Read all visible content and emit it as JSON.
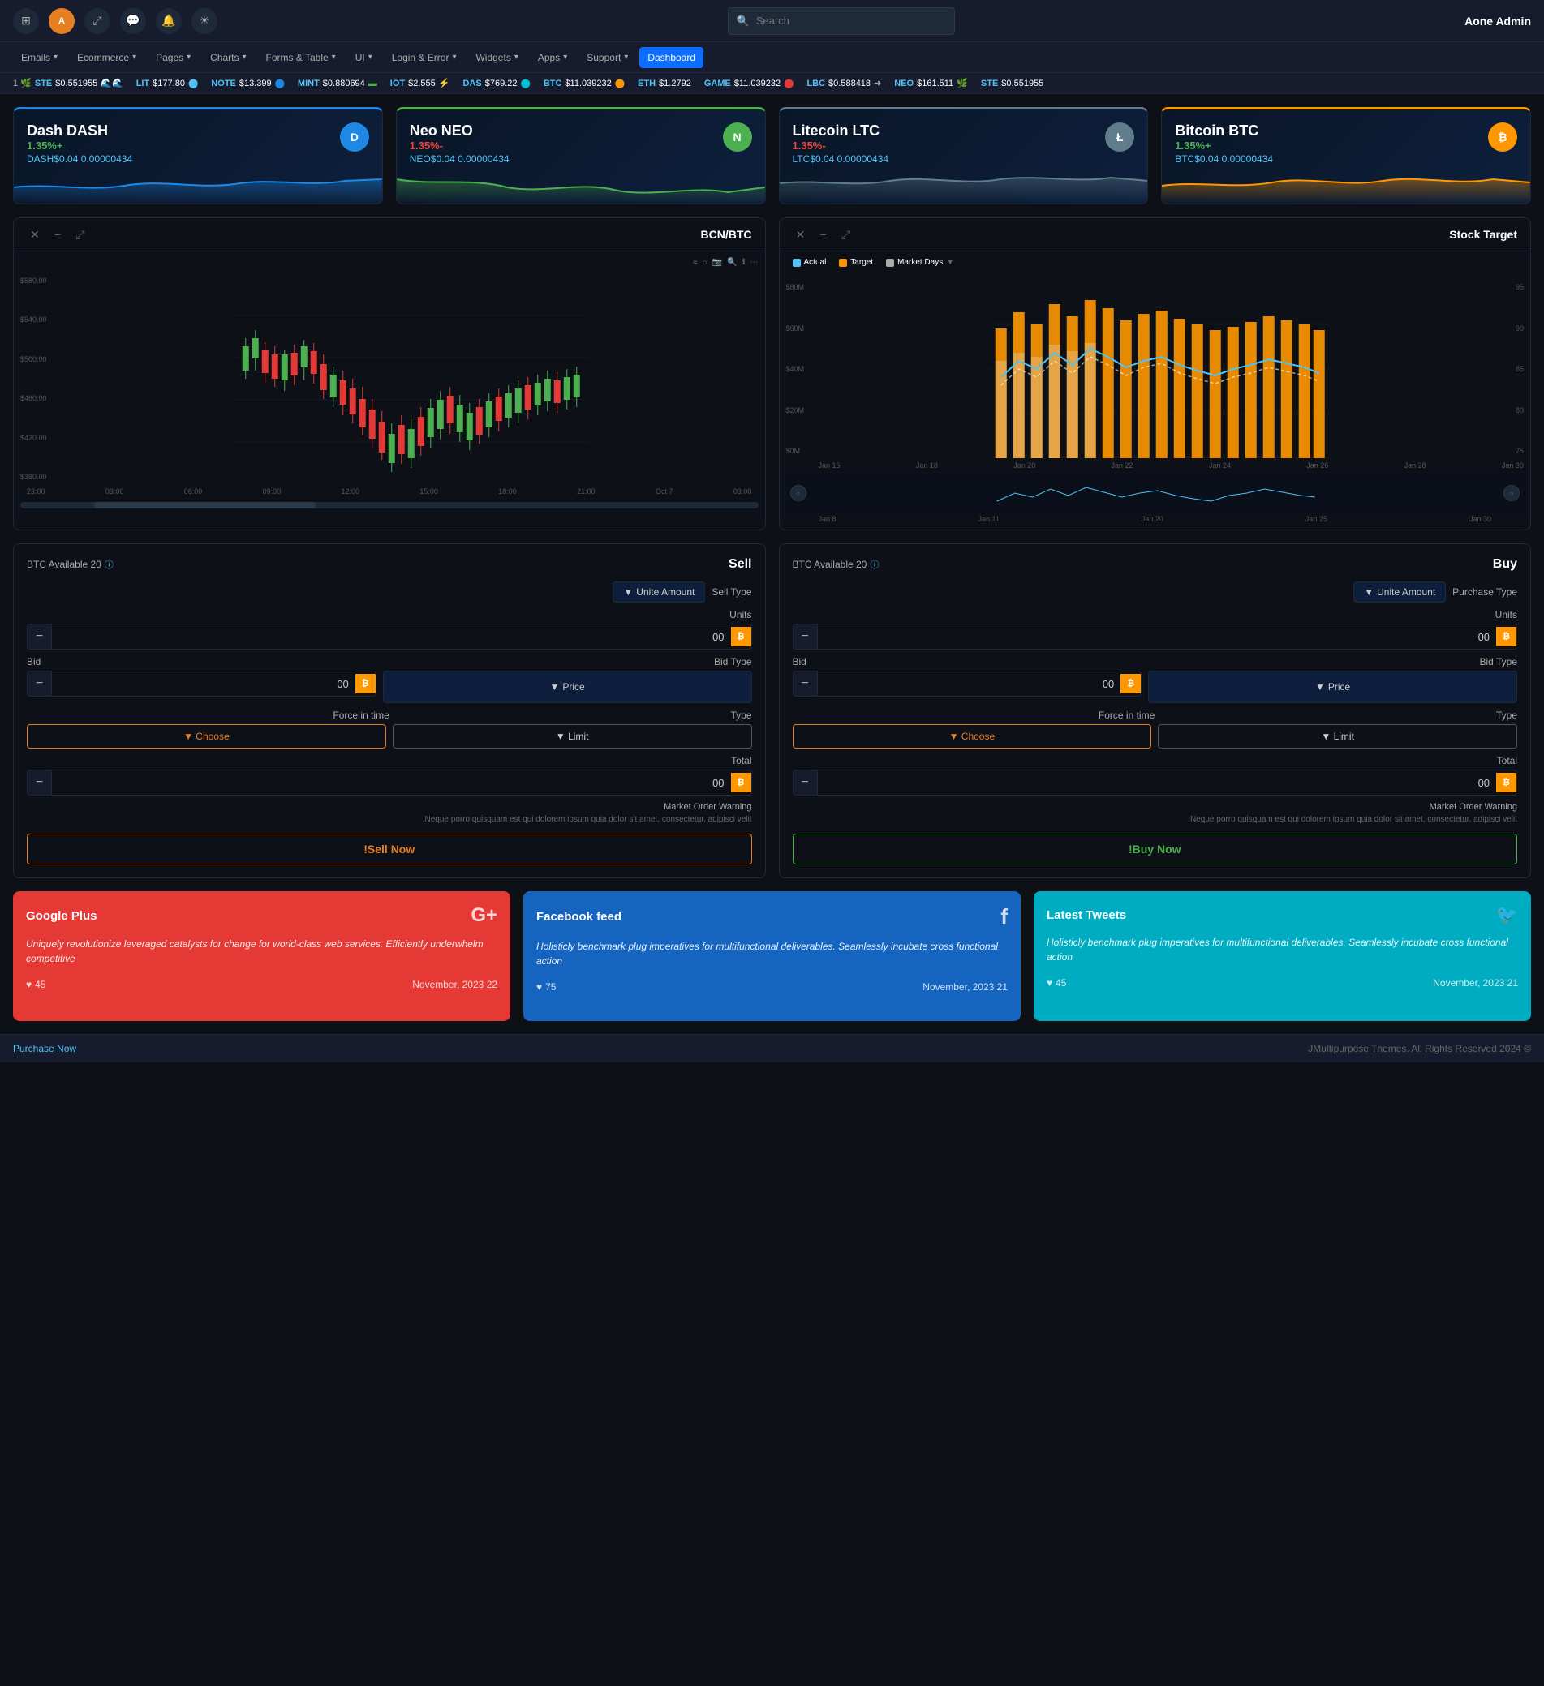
{
  "nav": {
    "icons": [
      "grid-icon",
      "avatar-icon",
      "expand-icon",
      "chat-bubble-icon",
      "bell-icon",
      "sun-icon"
    ],
    "avatar_text": "A",
    "search_placeholder": "Search",
    "admin_name": "Aone  Admin"
  },
  "menu": {
    "items": [
      {
        "label": "Emails",
        "arrow": true
      },
      {
        "label": "Ecommerce",
        "arrow": true
      },
      {
        "label": "Pages",
        "arrow": true
      },
      {
        "label": "Charts",
        "arrow": true
      },
      {
        "label": "Forms & Table",
        "arrow": true
      },
      {
        "label": "UI",
        "arrow": true
      },
      {
        "label": "Login & Error",
        "arrow": true
      },
      {
        "label": "Widgets",
        "arrow": true
      },
      {
        "label": "Apps",
        "arrow": true
      },
      {
        "label": "Support",
        "arrow": true
      },
      {
        "label": "Dashboard",
        "arrow": false,
        "active": true
      }
    ]
  },
  "ticker": {
    "items": [
      {
        "num": "1",
        "name": "STE",
        "price": "$0.551955"
      },
      {
        "name": "LIT",
        "price": "$177.80"
      },
      {
        "name": "NOTE",
        "price": "$13.399"
      },
      {
        "name": "MINT",
        "price": "$0.880694"
      },
      {
        "name": "IOT",
        "price": "$2.555"
      },
      {
        "name": "DAS",
        "price": "$769.22"
      },
      {
        "name": "BTC",
        "price": "$11.039232"
      },
      {
        "name": "ETH",
        "price": "$1.2792"
      },
      {
        "name": "GAME",
        "price": "$11.039232"
      },
      {
        "name": "LBC",
        "price": "$0.588418"
      },
      {
        "name": "NEO",
        "price": "$161.511"
      },
      {
        "name": "STE",
        "price": "$0.551955"
      }
    ]
  },
  "coins": [
    {
      "name": "Dash DASH",
      "symbol": "DASH",
      "change": "1.35%+",
      "positive": true,
      "price": "DASH",
      "amount": "$0.04",
      "sub": "0.00000434",
      "type": "dash",
      "icon": "D"
    },
    {
      "name": "Neo NEO",
      "symbol": "NEO",
      "change": "1.35%-",
      "positive": false,
      "price": "NEO",
      "amount": "$0.04",
      "sub": "0.00000434",
      "type": "neo",
      "icon": "N"
    },
    {
      "name": "Litecoin LTC",
      "symbol": "LTC",
      "change": "1.35%-",
      "positive": false,
      "price": "LTC",
      "amount": "$0.04",
      "sub": "0.00000434",
      "type": "ltc",
      "icon": "Ł"
    },
    {
      "name": "Bitcoin BTC",
      "symbol": "BTC",
      "change": "1.35%+",
      "positive": true,
      "price": "BTC",
      "amount": "$0.04",
      "sub": "0.00000434",
      "type": "btc",
      "icon": "₿"
    }
  ],
  "charts": {
    "left": {
      "title": "BCN/BTC",
      "price_labels": [
        "$580.00",
        "$540.00",
        "$500.00",
        "$460.00",
        "$420.00",
        "$380.00"
      ],
      "time_labels": [
        "23:00",
        "03:00",
        "06:00",
        "09:00",
        "12:00",
        "15:00",
        "18:00",
        "21:00",
        "Oct 7",
        "03:00"
      ]
    },
    "right": {
      "title": "Stock Target",
      "legend": [
        {
          "label": "Actual",
          "color": "#4fc3f7"
        },
        {
          "label": "Target",
          "color": "#ff9800"
        },
        {
          "label": "Market Days",
          "color": "#aaa"
        }
      ],
      "y_labels": [
        "$80M",
        "$60M",
        "$40M",
        "$20M",
        "$0M"
      ],
      "x_labels": [
        "Jan 16",
        "Jan 18",
        "Jan 20",
        "Jan 22",
        "Jan 24",
        "Jan 26",
        "Jan 28",
        "Jan 30"
      ],
      "right_labels": [
        "95",
        "90",
        "85",
        "80",
        "75"
      ]
    }
  },
  "sell_panel": {
    "available_label": "BTC Available 20",
    "title": "Sell",
    "unite_amount": "Unite Amount",
    "sell_type": "Sell Type",
    "units_label": "Units",
    "bid_label": "Bid",
    "bid_type": "Bid Type",
    "price_btn": "Price",
    "force_label": "Force in time",
    "type_label": "Type",
    "choose_btn": "Choose",
    "limit_btn": "Limit",
    "total_label": "Total",
    "warning_title": "Market Order Warning",
    "warning_text": ".Neque porro quisquam est qui dolorem ipsum quia dolor sit amet, consectetur, adipisci velit",
    "action_btn": "!Sell Now",
    "input_value": "00"
  },
  "buy_panel": {
    "available_label": "BTC Available 20",
    "title": "Buy",
    "unite_amount": "Unite Amount",
    "purchase_type": "Purchase Type",
    "units_label": "Units",
    "bid_label": "Bid",
    "bid_type": "Bid Type",
    "price_btn": "Price",
    "force_label": "Force in time",
    "type_label": "Type",
    "choose_btn": "Choose",
    "limit_btn": "Limit",
    "total_label": "Total",
    "warning_title": "Market Order Warning",
    "warning_text": ".Neque porro quisquam est qui dolorem ipsum quia dolor sit amet, consectetur, adipisci velit",
    "action_btn": "!Buy Now",
    "input_value": "00"
  },
  "social": {
    "google": {
      "title": "Google Plus",
      "icon": "G+",
      "text": "Uniquely revolutionize leveraged catalysts for change for world-class web services. Efficiently underwhelm competitive",
      "likes": "45",
      "date": "November, 2023 22"
    },
    "facebook": {
      "title": "Facebook feed",
      "icon": "f",
      "text": "Holisticly benchmark plug imperatives for multifunctional deliverables. Seamlessly incubate cross functional action",
      "likes": "75",
      "date": "November, 2023 21"
    },
    "twitter": {
      "title": "Latest Tweets",
      "icon": "🐦",
      "text": "Holisticly benchmark plug imperatives for multifunctional deliverables. Seamlessly incubate cross functional action",
      "likes": "45",
      "date": "November, 2023 21"
    }
  },
  "footer": {
    "left": "Purchase Now",
    "right": "JMultipurpose Themes. All Rights Reserved 2024 ©"
  }
}
